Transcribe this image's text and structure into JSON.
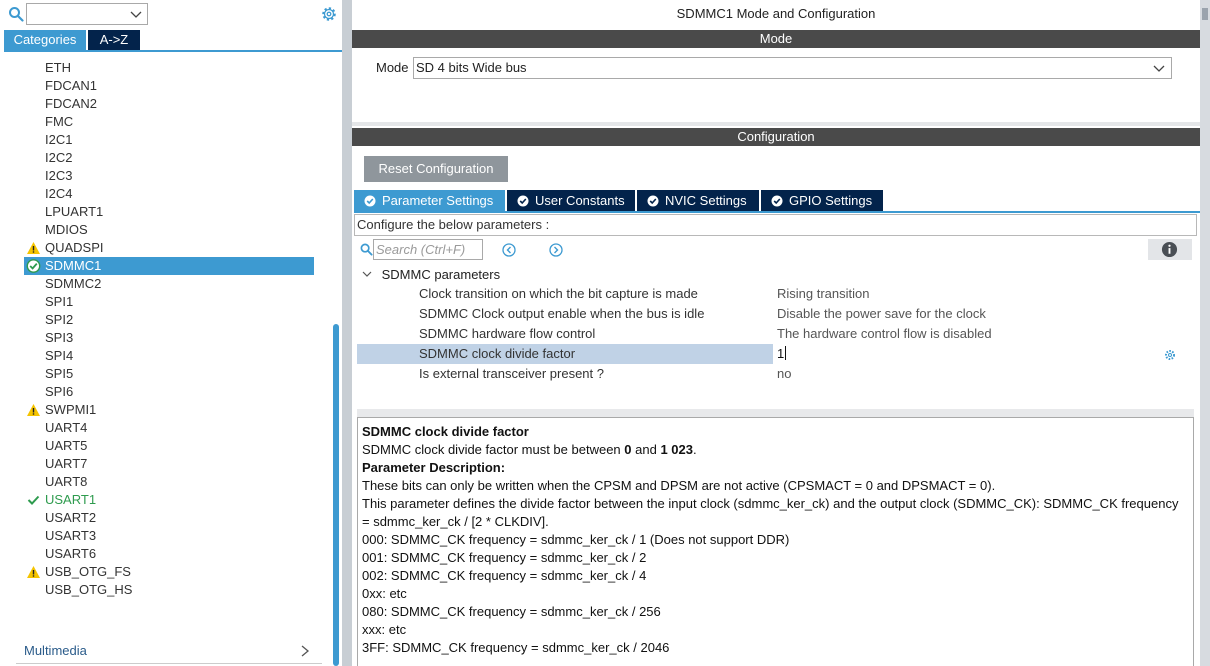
{
  "left": {
    "search": {
      "value": ""
    },
    "tabs": [
      {
        "label": "Categories"
      },
      {
        "label": "A->Z"
      }
    ],
    "items": [
      {
        "label": "ETH",
        "status": "none"
      },
      {
        "label": "FDCAN1",
        "status": "none"
      },
      {
        "label": "FDCAN2",
        "status": "none"
      },
      {
        "label": "FMC",
        "status": "none"
      },
      {
        "label": "I2C1",
        "status": "none"
      },
      {
        "label": "I2C2",
        "status": "none"
      },
      {
        "label": "I2C3",
        "status": "none"
      },
      {
        "label": "I2C4",
        "status": "none"
      },
      {
        "label": "LPUART1",
        "status": "none"
      },
      {
        "label": "MDIOS",
        "status": "none"
      },
      {
        "label": "QUADSPI",
        "status": "warning"
      },
      {
        "label": "SDMMC1",
        "status": "selected"
      },
      {
        "label": "SDMMC2",
        "status": "none"
      },
      {
        "label": "SPI1",
        "status": "none"
      },
      {
        "label": "SPI2",
        "status": "none"
      },
      {
        "label": "SPI3",
        "status": "none"
      },
      {
        "label": "SPI4",
        "status": "none"
      },
      {
        "label": "SPI5",
        "status": "none"
      },
      {
        "label": "SPI6",
        "status": "none"
      },
      {
        "label": "SWPMI1",
        "status": "warning"
      },
      {
        "label": "UART4",
        "status": "none"
      },
      {
        "label": "UART5",
        "status": "none"
      },
      {
        "label": "UART7",
        "status": "none"
      },
      {
        "label": "UART8",
        "status": "none"
      },
      {
        "label": "USART1",
        "status": "ok"
      },
      {
        "label": "USART2",
        "status": "none"
      },
      {
        "label": "USART3",
        "status": "none"
      },
      {
        "label": "USART6",
        "status": "none"
      },
      {
        "label": "USB_OTG_FS",
        "status": "warning"
      },
      {
        "label": "USB_OTG_HS",
        "status": "none"
      }
    ],
    "category_footer": "Multimedia"
  },
  "right": {
    "title": "SDMMC1 Mode and Configuration",
    "mode_section": "Mode",
    "mode_label": "Mode",
    "mode_value": "SD 4 bits Wide bus",
    "config_section": "Configuration",
    "reset_button": "Reset Configuration",
    "tabs": [
      {
        "label": "Parameter Settings",
        "active": true
      },
      {
        "label": "User Constants",
        "active": false
      },
      {
        "label": "NVIC Settings",
        "active": false
      },
      {
        "label": "GPIO Settings",
        "active": false
      }
    ],
    "configure_text": "Configure the below parameters :",
    "search_placeholder": "Search (Ctrl+F)",
    "group_label": "SDMMC parameters",
    "params": [
      {
        "name": "Clock transition on which the bit capture is made",
        "value": "Rising transition"
      },
      {
        "name": "SDMMC Clock output enable when the bus is idle",
        "value": "Disable the power save for the clock"
      },
      {
        "name": "SDMMC hardware flow control",
        "value": "The hardware control flow is disabled"
      },
      {
        "name": "SDMMC clock divide factor",
        "value": "1"
      },
      {
        "name": "Is external transceiver present ?",
        "value": "no"
      }
    ],
    "description": {
      "title": "SDMMC clock divide factor",
      "range_prefix": "SDMMC clock divide factor must be between ",
      "range_min": "0",
      "range_and": " and ",
      "range_max": "1 023",
      "range_suffix": ".",
      "param_desc_heading": "Parameter Description:",
      "lines": [
        "These bits can only be written when the CPSM and DPSM are not active (CPSMACT = 0 and DPSMACT = 0).",
        "This parameter defines the divide factor between the input clock (sdmmc_ker_ck) and the output clock (SDMMC_CK): SDMMC_CK frequency = sdmmc_ker_ck / [2 * CLKDIV].",
        "000: SDMMC_CK frequency = sdmmc_ker_ck / 1 (Does not support DDR)",
        "001: SDMMC_CK frequency = sdmmc_ker_ck / 2",
        "002: SDMMC_CK frequency = sdmmc_ker_ck / 4",
        "0xx: etc",
        "080: SDMMC_CK frequency = sdmmc_ker_ck / 256",
        "xxx: etc",
        "3FF: SDMMC_CK frequency = sdmmc_ker_ck / 2046"
      ]
    }
  },
  "colors": {
    "accent": "#3d9ad1",
    "tab_dark": "#03234b",
    "section_bar": "#4a4a4a",
    "ok_green": "#2e9b4e",
    "warning_yellow": "#f5c400",
    "selected_row": "#c0d2e6"
  },
  "icons": {
    "search": "search-icon",
    "settings": "gear-icon",
    "warning": "warning-icon",
    "ok": "check-circle-icon",
    "info": "info-icon",
    "prev": "arrow-left-circle-icon",
    "next": "arrow-right-circle-icon"
  }
}
